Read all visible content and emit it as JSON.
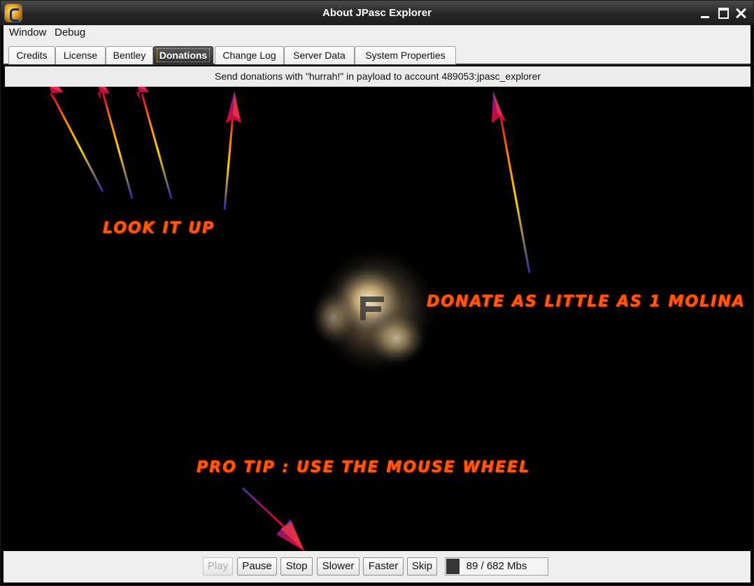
{
  "window": {
    "title": "About JPasc Explorer"
  },
  "menu": {
    "items": [
      "Window",
      "Debug"
    ]
  },
  "tabs": [
    "Credits",
    "License",
    "Bentley",
    "Donations",
    "Change Log",
    "Server Data",
    "System Properties"
  ],
  "active_tab": "Donations",
  "banner": "Send donations with \"hurrah!\" in payload to account 489053:jpasc_explorer",
  "overlay": {
    "look_it_up": "LOOK IT UP",
    "donate": "DONATE AS LITTLE AS 1 MOLINA",
    "pro_tip": "PRO TIP : USE THE MOUSE WHEEL"
  },
  "controls": {
    "play": "Play",
    "pause": "Pause",
    "stop": "Stop",
    "slower": "Slower",
    "faster": "Faster",
    "skip": "Skip"
  },
  "progress": {
    "text": "89 / 682 Mbs",
    "fraction": 0.13
  },
  "colors": {
    "neon": "#ff5a0a",
    "titlebar": "#262626",
    "panel": "#eeeeee"
  }
}
